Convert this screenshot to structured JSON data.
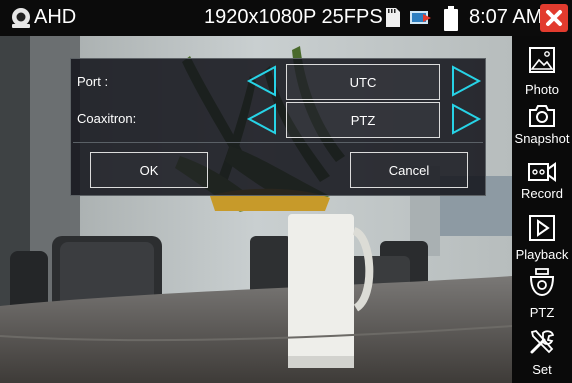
{
  "statusbar": {
    "mode": "AHD",
    "resolution": "1920x1080P 25FPS",
    "time": "8:07 AM"
  },
  "dialog": {
    "port_label": "Port :",
    "port_value": "UTC",
    "coaxitron_label": "Coaxitron:",
    "coaxitron_value": "PTZ",
    "ok_label": "OK",
    "cancel_label": "Cancel"
  },
  "sidemenu": {
    "items": [
      {
        "label": "Photo",
        "icon": "photo-icon"
      },
      {
        "label": "Snapshot",
        "icon": "camera-icon"
      },
      {
        "label": "Record",
        "icon": "video-icon"
      },
      {
        "label": "Playback",
        "icon": "play-icon"
      },
      {
        "label": "PTZ",
        "icon": "ptz-camera-icon"
      },
      {
        "label": "Set",
        "icon": "tools-icon"
      }
    ]
  },
  "colors": {
    "accent_cyan": "#27d3e6",
    "close_red": "#e23b2e",
    "dialog_bg": "#14161c"
  }
}
